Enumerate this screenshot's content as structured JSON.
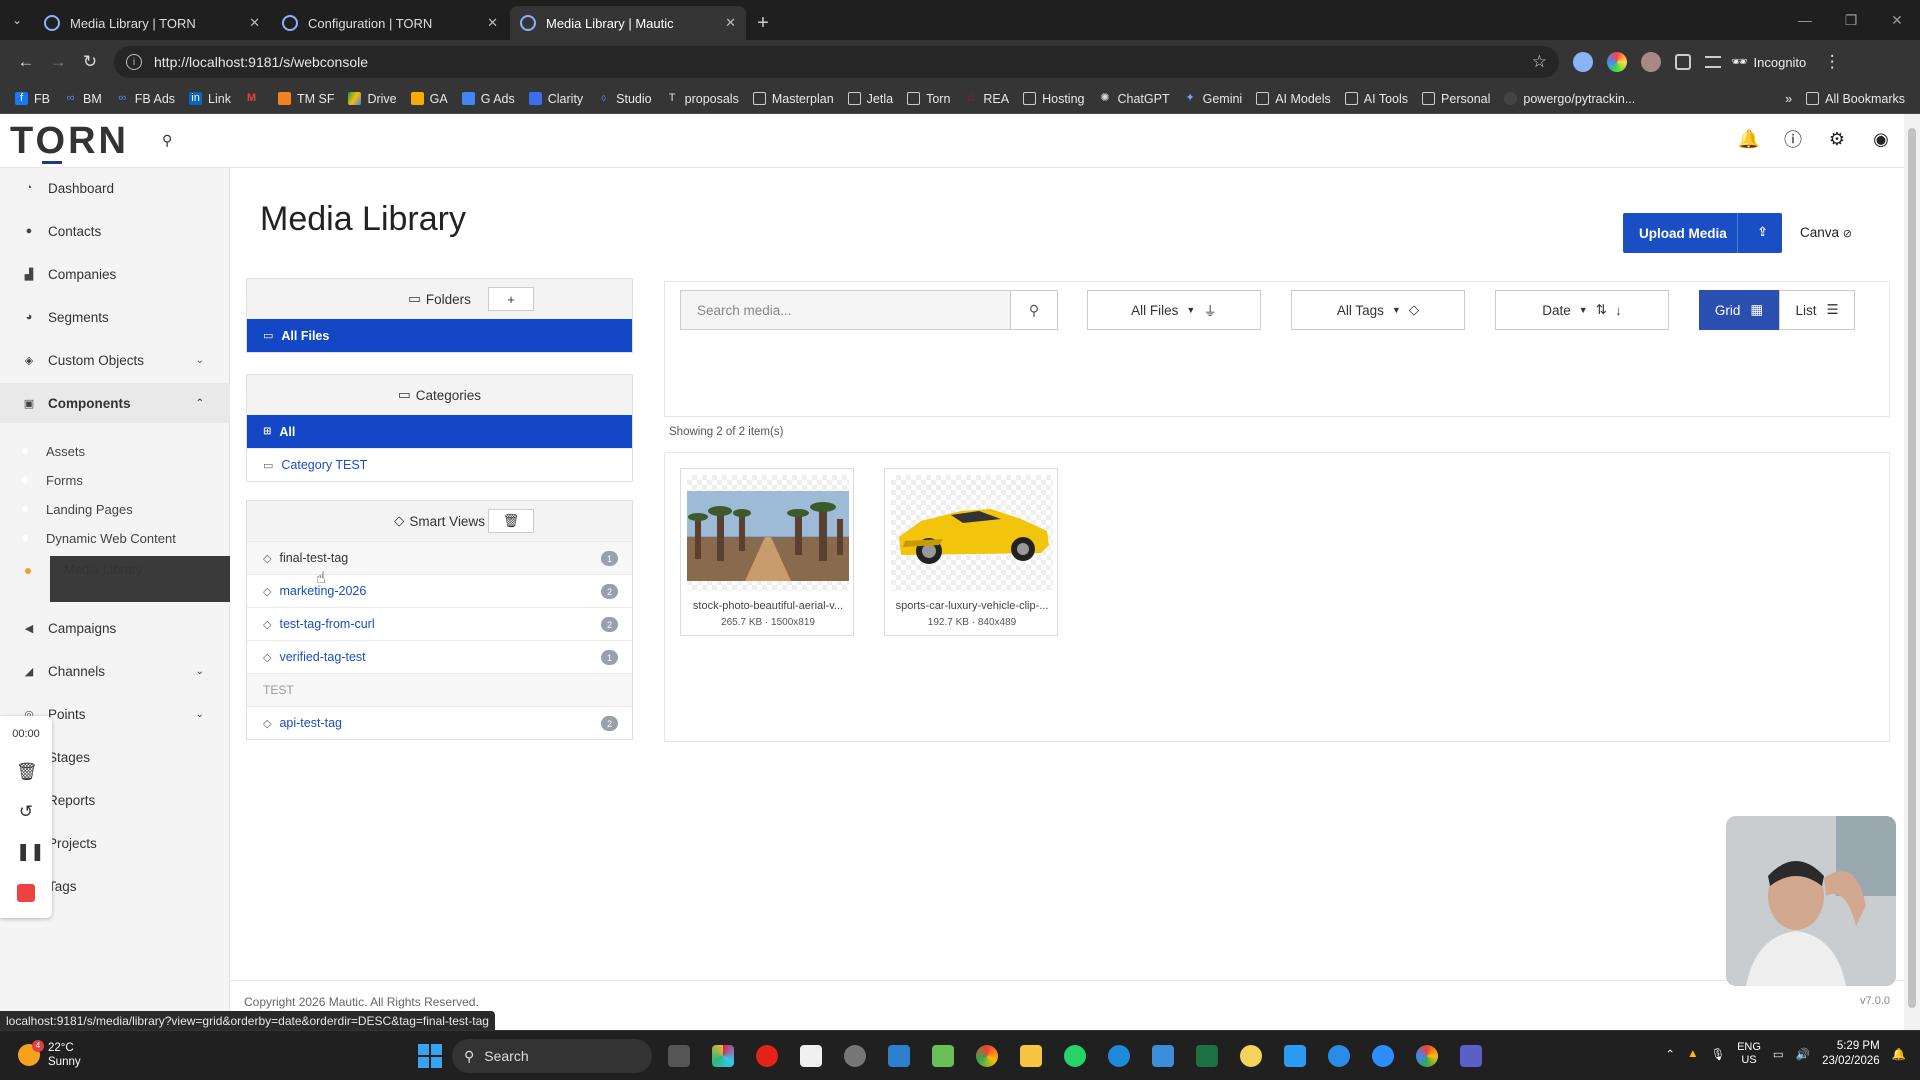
{
  "browser": {
    "tabs": [
      {
        "title": "Media Library | TORN",
        "active": false
      },
      {
        "title": "Configuration | TORN",
        "active": false
      },
      {
        "title": "Media Library | Mautic",
        "active": true
      }
    ],
    "url": "http://localhost:9181/s/webconsole",
    "incognito_label": "Incognito",
    "bookmarks": [
      "FB",
      "BM",
      "FB Ads",
      "Link",
      "M",
      "TM SF",
      "Drive",
      "GA",
      "G Ads",
      "Clarity",
      "Studio",
      "proposals",
      "Masterplan",
      "Jetla",
      "Torn",
      "REA",
      "Hosting",
      "ChatGPT",
      "Gemini",
      "AI Models",
      "AI Tools",
      "Personal",
      "powergo/pytrackin..."
    ],
    "all_bookmarks_label": "All Bookmarks",
    "status_url": "localhost:9181/s/media/library?view=grid&orderby=date&orderdir=DESC&tag=final-test-tag"
  },
  "app": {
    "logo": "TORN",
    "sidebar": {
      "items": [
        {
          "label": "Dashboard",
          "icon": "dashboard-icon"
        },
        {
          "label": "Contacts",
          "icon": "user-icon"
        },
        {
          "label": "Companies",
          "icon": "building-icon"
        },
        {
          "label": "Segments",
          "icon": "pie-icon"
        },
        {
          "label": "Custom Objects",
          "icon": "layers-icon",
          "caret": "down"
        },
        {
          "label": "Components",
          "icon": "puzzle-icon",
          "caret": "up",
          "open": true
        },
        {
          "label": "Campaigns",
          "icon": "megaphone-icon"
        },
        {
          "label": "Channels",
          "icon": "rss-icon",
          "caret": "down"
        },
        {
          "label": "Points",
          "icon": "target-icon",
          "caret": "down"
        },
        {
          "label": "Stages",
          "icon": "stages-icon"
        },
        {
          "label": "Reports",
          "icon": "report-icon"
        },
        {
          "label": "Projects",
          "icon": "project-icon"
        },
        {
          "label": "Tags",
          "icon": "tag-icon"
        }
      ],
      "component_subitems": [
        "Assets",
        "Forms",
        "Landing Pages",
        "Dynamic Web Content",
        "Media Library"
      ]
    },
    "recorder": {
      "time": "00:00"
    },
    "page_title": "Media Library",
    "upload_label": "Upload Media",
    "canva_label": "Canva",
    "folders": {
      "title": "Folders",
      "add": "+",
      "all_files": "All Files"
    },
    "categories": {
      "title": "Categories",
      "all": "All",
      "items": [
        "Category TEST"
      ]
    },
    "smart_views": {
      "title": "Smart Views",
      "items": [
        {
          "label": "final-test-tag",
          "count": "1",
          "hover": true
        },
        {
          "label": "marketing-2026",
          "count": "2"
        },
        {
          "label": "test-tag-from-curl",
          "count": "2"
        },
        {
          "label": "verified-tag-test",
          "count": "1"
        }
      ],
      "group_label": "TEST",
      "group_items": [
        {
          "label": "api-test-tag",
          "count": "2"
        }
      ]
    },
    "filters": {
      "search_placeholder": "Search media...",
      "file_type": "All Files",
      "tags": "All Tags",
      "sort": "Date",
      "grid": "Grid",
      "list": "List"
    },
    "showing": "Showing 2 of 2 item(s)",
    "media": [
      {
        "name": "stock-photo-beautiful-aerial-v...",
        "meta": "265.7 KB · 1500x819"
      },
      {
        "name": "sports-car-luxury-vehicle-clip-...",
        "meta": "192.7 KB · 840x489"
      }
    ],
    "footer": {
      "copyright": "Copyright 2026 Mautic. All Rights Reserved.",
      "version": "v7.0.0"
    }
  },
  "taskbar": {
    "temp": "22°C",
    "weather": "Sunny",
    "search_label": "Search",
    "lang": "ENG",
    "region": "US",
    "time": "5:29 PM",
    "date": "23/02/2026"
  },
  "colors": {
    "primary": "#1347c5",
    "grid_active": "#2b4fb0",
    "sidebar_bg": "#f4f4f4"
  }
}
